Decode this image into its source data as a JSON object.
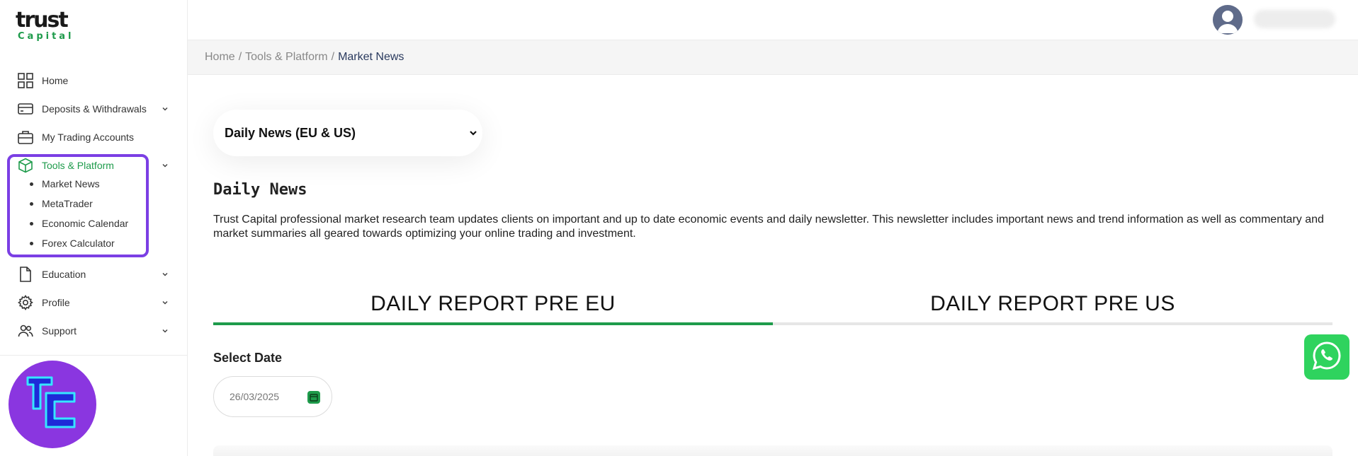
{
  "logo": {
    "top": "trust",
    "bottom": "Capital"
  },
  "sidebar": {
    "items": [
      {
        "label": "Home",
        "icon": "grid-icon"
      },
      {
        "label": "Deposits & Withdrawals",
        "icon": "credit-card-icon",
        "has_chevron": true
      },
      {
        "label": "My Trading Accounts",
        "icon": "briefcase-icon"
      },
      {
        "label": "Tools & Platform",
        "icon": "cube-icon",
        "has_chevron": true,
        "active": true
      },
      {
        "label": "Education",
        "icon": "document-icon",
        "has_chevron": true
      },
      {
        "label": "Profile",
        "icon": "gear-icon",
        "has_chevron": true
      },
      {
        "label": "Support",
        "icon": "users-icon",
        "has_chevron": true
      }
    ],
    "sub_items": [
      "Market News",
      "MetaTrader",
      "Economic Calendar",
      "Forex Calculator"
    ]
  },
  "breadcrumb": {
    "home": "Home",
    "section": "Tools & Platform",
    "current": "Market News",
    "separator": "/"
  },
  "main": {
    "dropdown_selected": "Daily News (EU & US)",
    "title": "Daily News",
    "description": "Trust Capital professional market research team updates clients on important and up to date economic events and daily newsletter. This newsletter includes important news and trend information as well as commentary and market summaries all geared towards optimizing your online trading and investment.",
    "tabs": [
      {
        "label": "DAILY REPORT PRE EU",
        "active": true
      },
      {
        "label": "DAILY REPORT PRE US",
        "active": false
      }
    ],
    "select_date_label": "Select Date",
    "date_value": "26/03/2025"
  },
  "colors": {
    "accent": "#1e9b4b",
    "highlight": "#7b3fe4",
    "whatsapp": "#2fd35e",
    "badge": "#8a36e0"
  }
}
